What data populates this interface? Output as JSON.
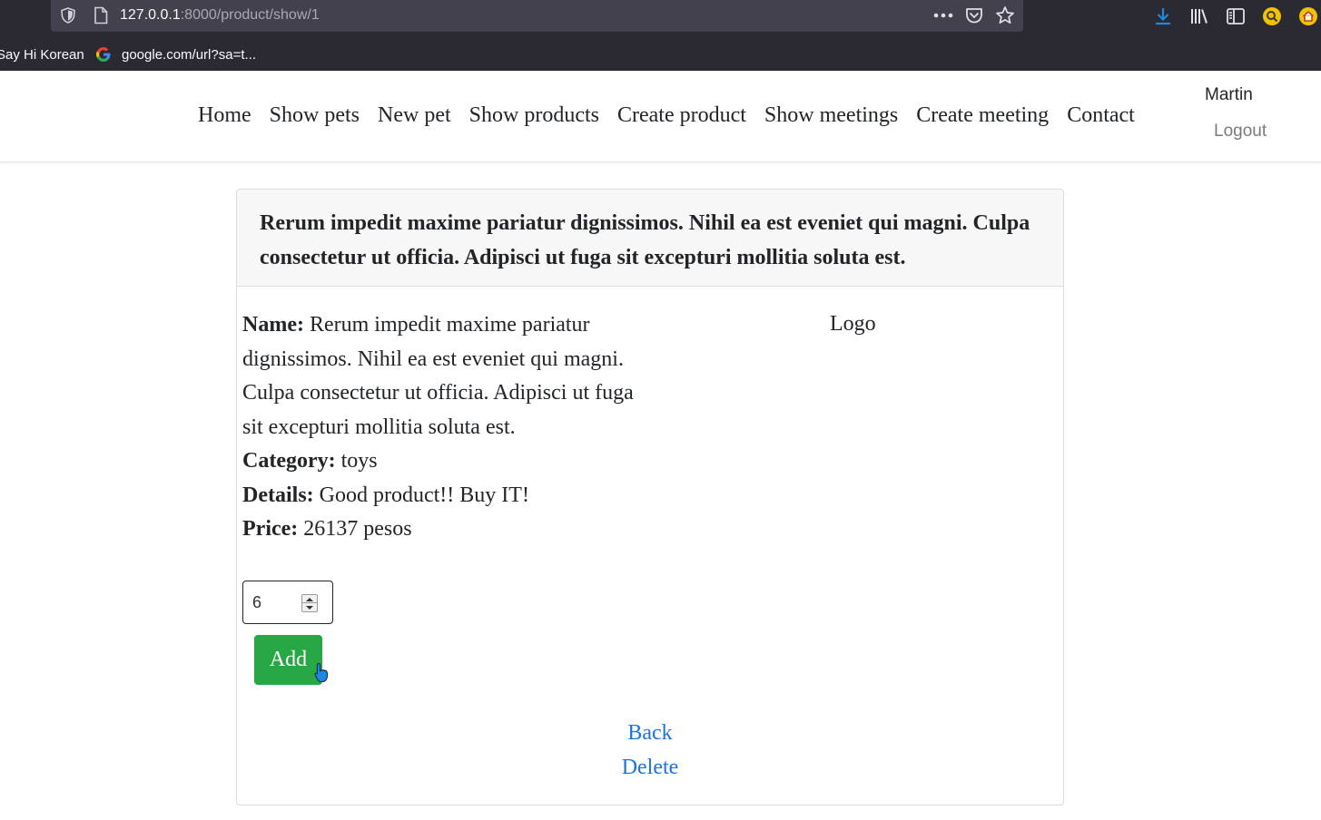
{
  "browser": {
    "url_host": "127.0.0.1",
    "url_path": ":8000/product/show/1",
    "bookmarks": [
      {
        "label": "Say Hi Korean"
      },
      {
        "label": "google.com/url?sa=t..."
      }
    ],
    "icons": [
      "shield-icon",
      "page-icon",
      "more-icon",
      "pocket-icon",
      "star-icon",
      "download-icon",
      "library-icon",
      "sidebar-icon",
      "extension-search-icon",
      "home-extension-icon"
    ],
    "accent_color": "#1e88e5"
  },
  "navbar": {
    "links": [
      "Home",
      "Show pets",
      "New pet",
      "Show products",
      "Create product",
      "Show meetings",
      "Create meeting",
      "Contact"
    ],
    "user": "Martin",
    "logout": "Logout"
  },
  "product": {
    "header": "Rerum impedit maxime pariatur dignissimos. Nihil ea est eveniet qui magni. Culpa consectetur ut officia. Adipisci ut fuga sit excepturi mollitia soluta est.",
    "name_label": "Name:",
    "name": "Rerum impedit maxime pariatur dignissimos. Nihil ea est eveniet qui magni. Culpa consectetur ut officia. Adipisci ut fuga sit excepturi mollitia soluta est.",
    "category_label": "Category:",
    "category": "toys",
    "details_label": "Details:",
    "details": "Good product!! Buy IT!",
    "price_label": "Price:",
    "price": "26137 pesos",
    "logo": "Logo"
  },
  "cart": {
    "quantity": "6",
    "add_label": "Add",
    "add_color": "#28a745"
  },
  "actions": {
    "back": "Back",
    "delete": "Delete",
    "link_color": "#1a73e8"
  }
}
